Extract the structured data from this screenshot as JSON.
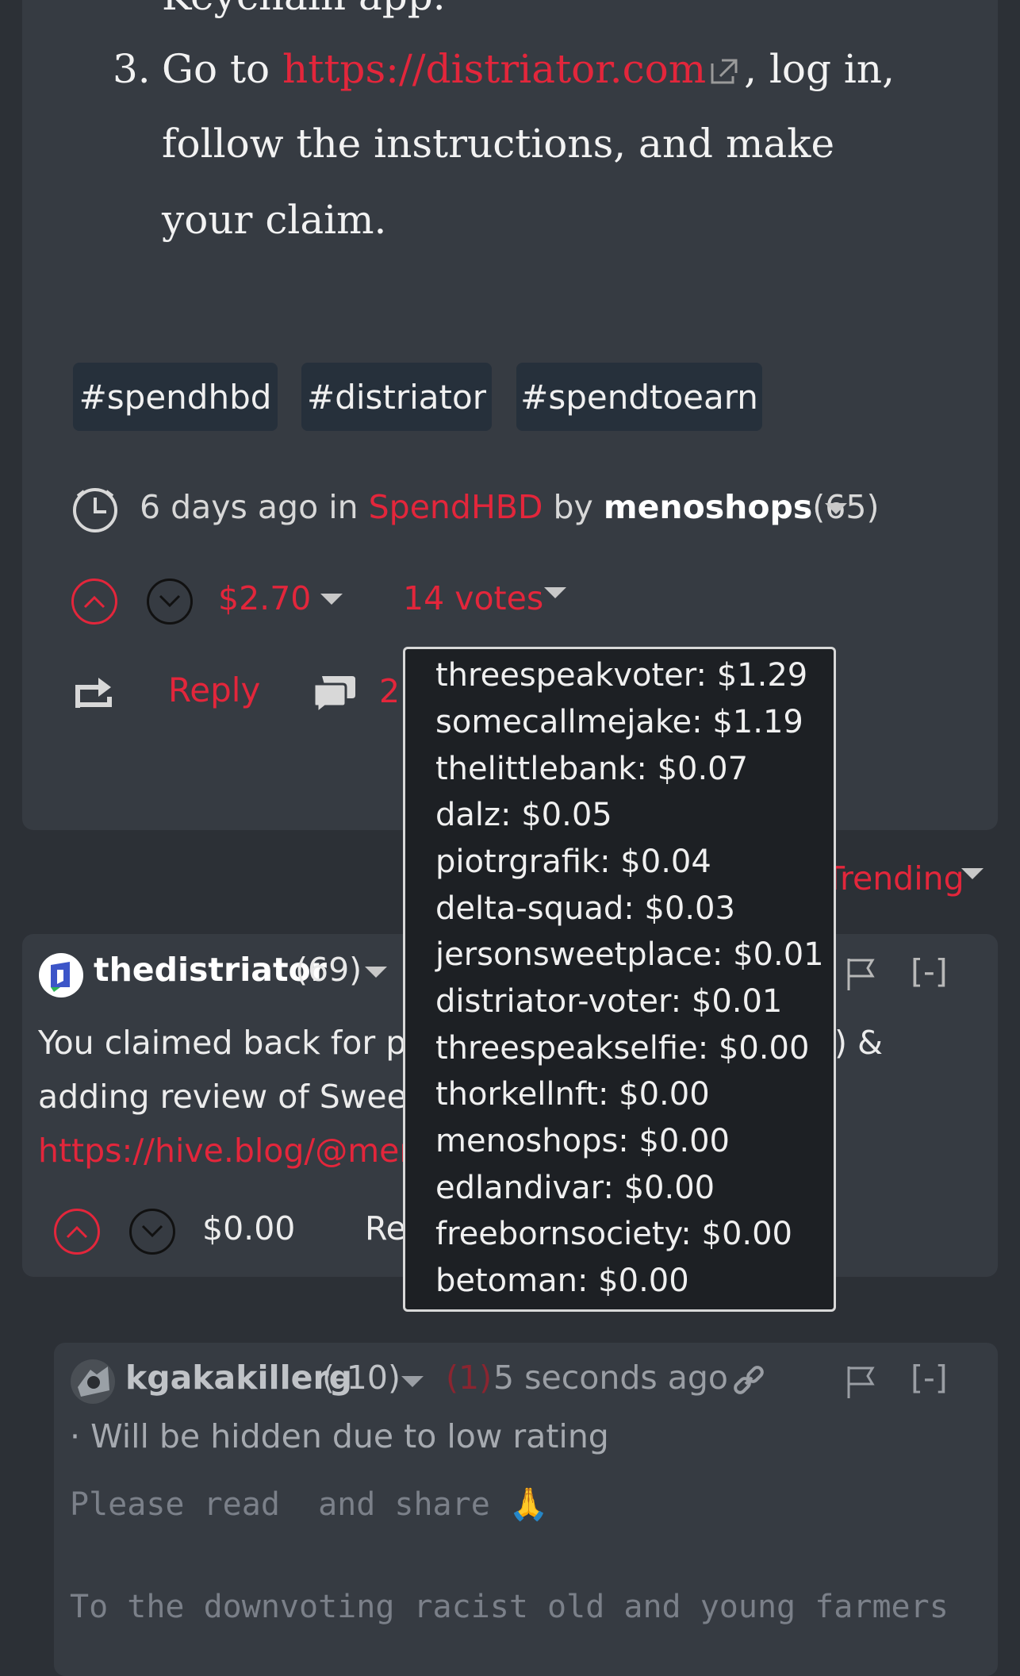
{
  "post": {
    "top_clipped_text": "Keychain app.",
    "step_number": "3.",
    "step_text_before": "Go to",
    "step_link": "https://distriator.com",
    "step_text_after": ", log in,",
    "step_line2": "follow the instructions, and make",
    "step_line3": "your claim.",
    "tags": [
      "#spendhbd",
      "#distriator",
      "#spendtoearn"
    ],
    "meta": {
      "time": "6 days ago",
      "in_label": "in",
      "community": "SpendHBD",
      "by_label": "by",
      "author": "menoshops",
      "reputation": "(65)"
    },
    "payout": "$2.70",
    "votes": "14 votes",
    "reply_label": "Reply",
    "comment_count": "2"
  },
  "sort": {
    "label": "Trending"
  },
  "tooltip": {
    "voters": [
      "threespeakvoter: $1.29",
      "somecallmejake: $1.19",
      "thelittlebank: $0.07",
      "dalz: $0.05",
      "piotrgrafik: $0.04",
      "delta-squad: $0.03",
      "jersonsweetplace: $0.01",
      "distriator-voter: $0.01",
      "threespeakselfie: $0.00",
      "thorkellnft: $0.00",
      "menoshops: $0.00",
      "edlandivar: $0.00",
      "freebornsociety: $0.00",
      "betoman: $0.00"
    ]
  },
  "comment": {
    "author": "thedistriator",
    "reputation": "(69)",
    "line1_start": "You claimed back for pay",
    "line1_end": ") &",
    "line2_start": "adding review of Sweet S",
    "line3_link": "https://hive.blog/@men",
    "payout": "$0.00",
    "reply_partial": "Re",
    "collapse": "[-]"
  },
  "reply": {
    "author": "kgakakillerg",
    "reputation": "(-10)",
    "count": "(1)",
    "time": "5 seconds ago",
    "hidden_note": "· Will be hidden due to low rating",
    "body_line1": "Please read  and share 🙏",
    "body_line2": "To the downvoting racist old and young farmers",
    "collapse": "[-]"
  },
  "colors": {
    "background": "#2c3036",
    "card": "#363b42",
    "accent_red": "#e3263b",
    "tag_bg": "#26303b",
    "tooltip_bg": "#1d2024"
  }
}
